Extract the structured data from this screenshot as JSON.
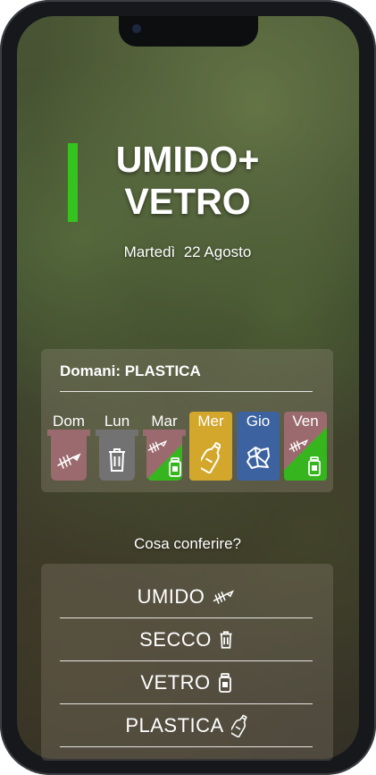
{
  "header": {
    "title_line1": "UMIDO+",
    "title_line2": "VETRO",
    "date": "Martedì  22 Agosto",
    "accent_color": "#35c31f"
  },
  "week": {
    "tomorrow": "Domani: PLASTICA",
    "days": [
      {
        "label": "Dom",
        "icon": "fish-bone-icon",
        "color": "#9b6a6e"
      },
      {
        "label": "Lun",
        "icon": "trash-icon",
        "color": "#737272"
      },
      {
        "label": "Mar",
        "icon": "fish-bone-and-jar-icon",
        "color": "#9b6a6e"
      },
      {
        "label": "Mer",
        "icon": "bottle-icon",
        "color": "#d3a72b"
      },
      {
        "label": "Gio",
        "icon": "crumpled-paper-icon",
        "color": "#3c62a0"
      },
      {
        "label": "Ven",
        "icon": "fish-bone-and-jar-icon",
        "color": "#36b51e"
      }
    ]
  },
  "guide": {
    "question": "Cosa conferire?",
    "items": [
      {
        "label": "UMIDO",
        "icon": "fish-bone-icon"
      },
      {
        "label": "SECCO",
        "icon": "trash-icon"
      },
      {
        "label": "VETRO",
        "icon": "jar-icon"
      },
      {
        "label": "PLASTICA",
        "icon": "bottle-icon"
      }
    ]
  }
}
